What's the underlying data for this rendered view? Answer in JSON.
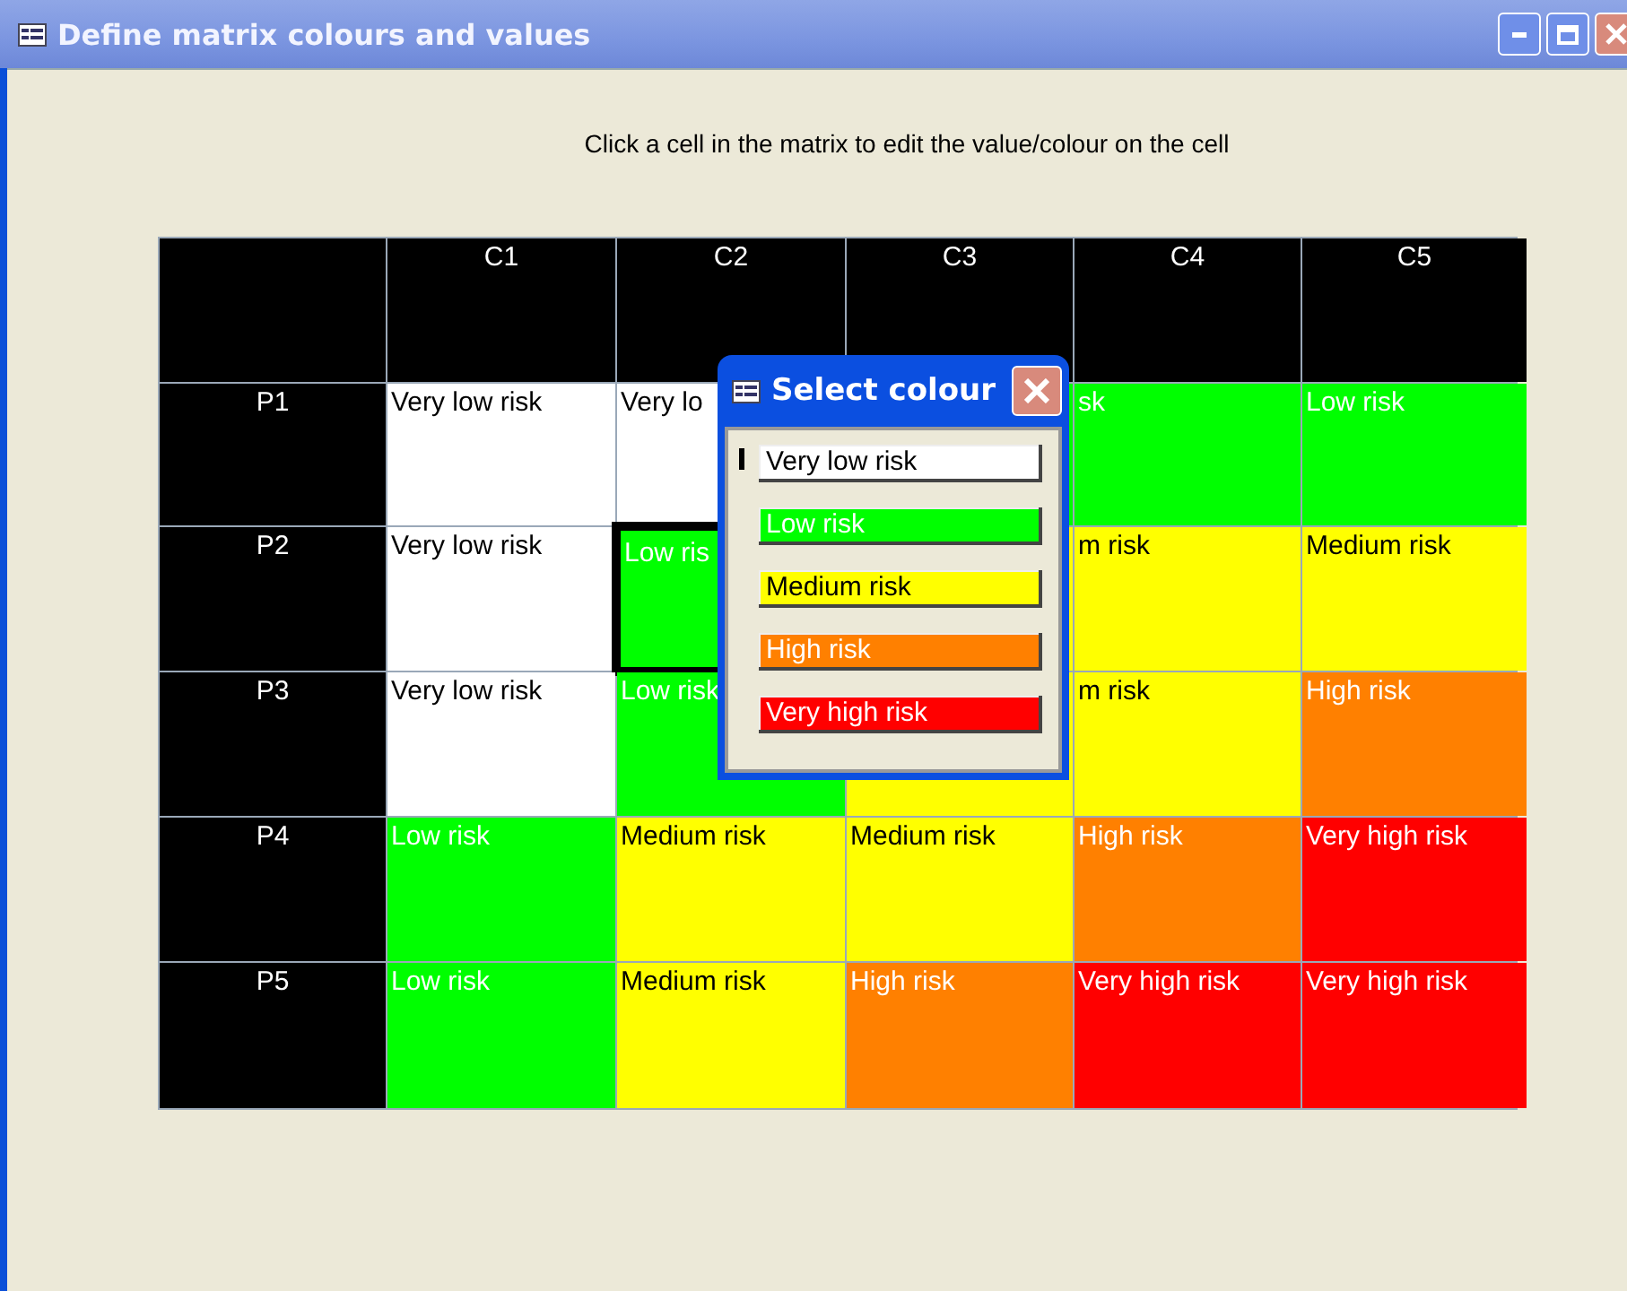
{
  "window": {
    "title": "Define matrix colours and values"
  },
  "instruction": "Click a cell in the matrix to edit the value/colour on the cell",
  "matrix": {
    "columns": [
      "C1",
      "C2",
      "C3",
      "C4",
      "C5"
    ],
    "rows": [
      {
        "label": "P1",
        "cells": [
          {
            "text": "Very low risk",
            "color": "#ffffff",
            "selected": false
          },
          {
            "text": "Very lo",
            "color": "#ffffff",
            "selected": false
          },
          {
            "color": "#00ff00",
            "selected": false
          },
          {
            "text": "sk",
            "color": "#00ff00",
            "selected": false
          },
          {
            "text": "Low risk",
            "color": "#00ff00",
            "selected": false
          }
        ]
      },
      {
        "label": "P2",
        "cells": [
          {
            "text": "Very low risk",
            "color": "#ffffff",
            "selected": false
          },
          {
            "text": "Low ris",
            "color": "#00ff00",
            "selected": true
          },
          {
            "color": "#ffff00",
            "selected": false
          },
          {
            "text": "m risk",
            "color": "#ffff00",
            "selected": false
          },
          {
            "text": "Medium risk",
            "color": "#ffff00",
            "selected": false
          }
        ]
      },
      {
        "label": "P3",
        "cells": [
          {
            "text": "Very low risk",
            "color": "#ffffff",
            "selected": false
          },
          {
            "text": "Low risk",
            "color": "#00ff00",
            "selected": false
          },
          {
            "color": "#ffff00",
            "selected": false
          },
          {
            "text": "m risk",
            "color": "#ffff00",
            "selected": false
          },
          {
            "text": "High risk",
            "color": "#ff8000",
            "selected": false
          }
        ]
      },
      {
        "label": "P4",
        "cells": [
          {
            "text": "Low risk",
            "color": "#00ff00",
            "selected": false
          },
          {
            "text": "Medium risk",
            "color": "#ffff00",
            "selected": false
          },
          {
            "text": "Medium risk",
            "color": "#ffff00",
            "selected": false
          },
          {
            "text": "High risk",
            "color": "#ff8000",
            "selected": false
          },
          {
            "text": "Very high risk",
            "color": "#ff0000",
            "selected": false
          }
        ]
      },
      {
        "label": "P5",
        "cells": [
          {
            "text": "Low risk",
            "color": "#00ff00",
            "selected": false
          },
          {
            "text": "Medium risk",
            "color": "#ffff00",
            "selected": false
          },
          {
            "text": "High risk",
            "color": "#ff8000",
            "selected": false
          },
          {
            "text": "Very high risk",
            "color": "#ff0000",
            "selected": false
          },
          {
            "text": "Very high risk",
            "color": "#ff0000",
            "selected": false
          }
        ]
      }
    ]
  },
  "dialog": {
    "title": "Select colour",
    "options": [
      {
        "label": "Very low risk",
        "color": "#ffffff"
      },
      {
        "label": "Low risk",
        "color": "#00ff00"
      },
      {
        "label": "Medium risk",
        "color": "#ffff00"
      },
      {
        "label": "High risk",
        "color": "#ff8000"
      },
      {
        "label": "Very high risk",
        "color": "#ff0000"
      }
    ]
  }
}
